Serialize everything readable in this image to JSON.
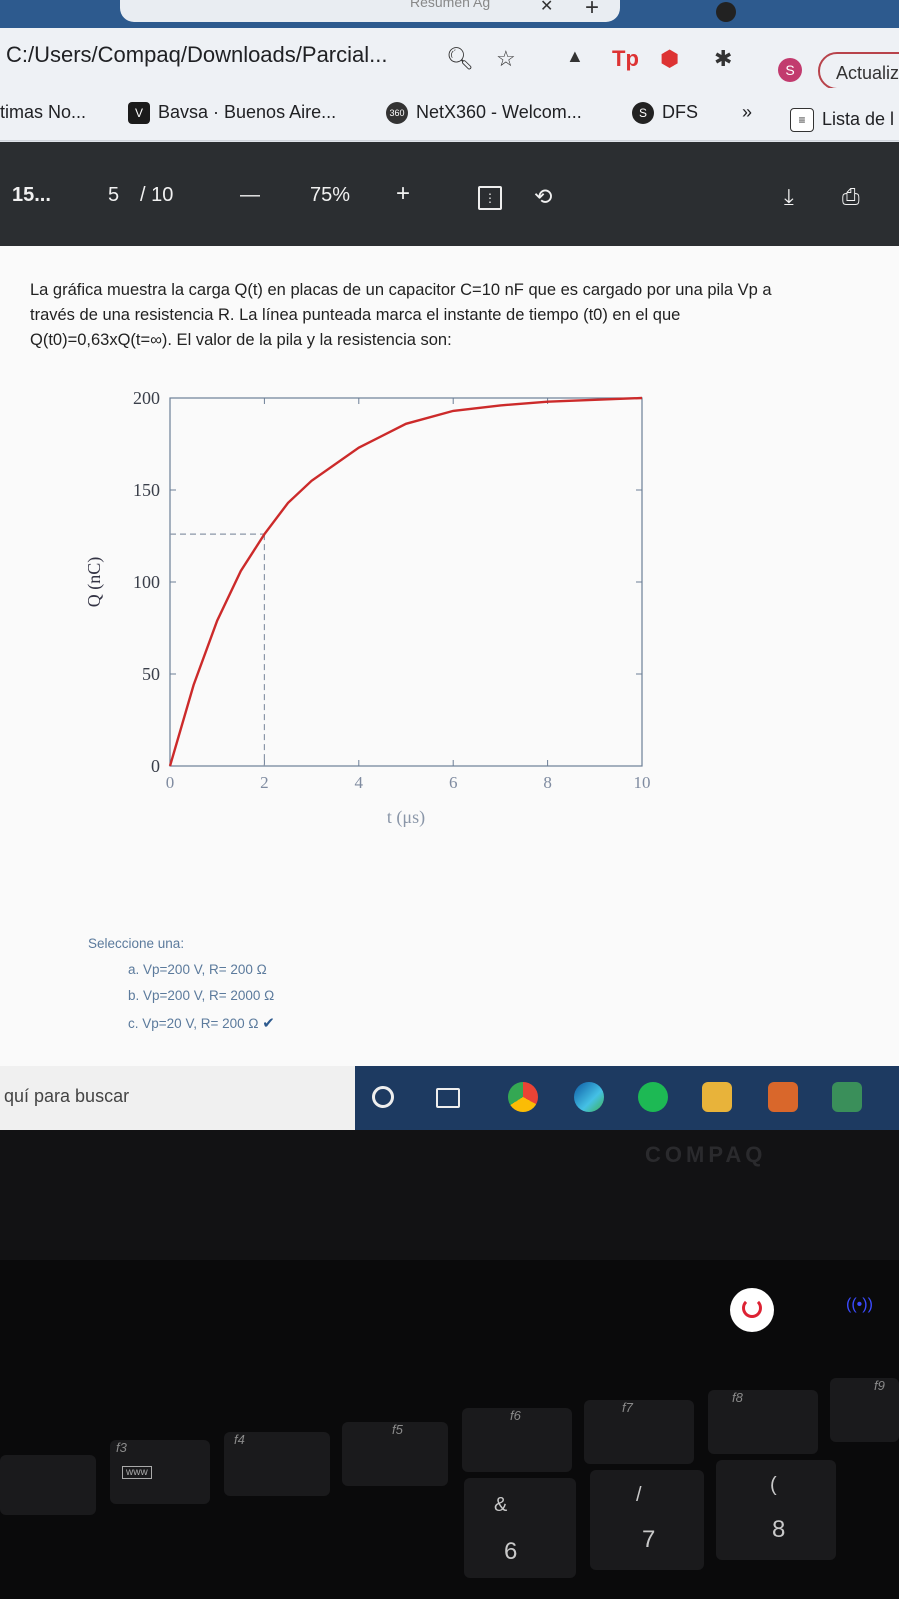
{
  "browser": {
    "tab_title": "Resumen Ag",
    "url": "C:/Users/Compaq/Downloads/Parcial...",
    "profile_initial": "S",
    "update_label": "Actualiz",
    "bookmarks": [
      {
        "label": "timas No...",
        "icon": "none"
      },
      {
        "label": "Bavsa · Buenos Aire...",
        "icon": "V"
      },
      {
        "label": "NetX360 - Welcom...",
        "icon": "360"
      },
      {
        "label": "DFS",
        "icon": "S"
      },
      {
        "label": "»",
        "icon": "none"
      },
      {
        "label": "Lista de l",
        "icon": "list"
      }
    ]
  },
  "pdf_toolbar": {
    "title": "15...",
    "page_current": "5",
    "page_separator": "/ 10",
    "minus": "—",
    "zoom": "75%",
    "plus": "+"
  },
  "question": {
    "line1": "La gráfica muestra la carga Q(t) en placas de un capacitor C=10 nF que es cargado por una pila Vp a",
    "line2": "través de una resistencia R. La línea punteada marca el instante de tiempo (t0) en el que",
    "line3": "Q(t0)=0,63xQ(t=∞). El valor de la pila y la resistencia son:"
  },
  "chart_data": {
    "type": "line",
    "title": "",
    "xlabel": "t (μs)",
    "ylabel": "Q (nC)",
    "xlim": [
      0,
      10
    ],
    "ylim": [
      0,
      200
    ],
    "x_ticks": [
      "0",
      "2",
      "4",
      "6",
      "8",
      "10"
    ],
    "y_ticks": [
      "0",
      "50",
      "100",
      "150",
      "200"
    ],
    "series": [
      {
        "color": "#cc2a2a",
        "x": [
          0,
          0.5,
          1,
          1.5,
          2,
          2.5,
          3,
          4,
          5,
          6,
          7,
          8,
          9,
          10
        ],
        "y": [
          0,
          44,
          79,
          106,
          126,
          143,
          155,
          173,
          186,
          193,
          196,
          198,
          199,
          200
        ]
      }
    ],
    "marker_t0": 2,
    "marker_q": 126,
    "grid": false
  },
  "choices": {
    "prompt": "Seleccione una:",
    "options": [
      {
        "letter": "a.",
        "text": "Vp=200 V, R= 200 Ω"
      },
      {
        "letter": "b.",
        "text": "Vp=200 V, R= 2000 Ω"
      },
      {
        "letter": "c.",
        "text": "Vp=20 V, R= 200 Ω"
      }
    ],
    "checkmark": "✔"
  },
  "taskbar": {
    "search_placeholder": "quí para buscar"
  },
  "laptop": {
    "brand": "COMPAQ",
    "fkeys": [
      "f3",
      "f4",
      "f5",
      "f6",
      "f7",
      "f8",
      "f9"
    ],
    "keys": [
      "&",
      "6",
      "/",
      "7",
      "(",
      "8"
    ],
    "www_label": "www"
  }
}
